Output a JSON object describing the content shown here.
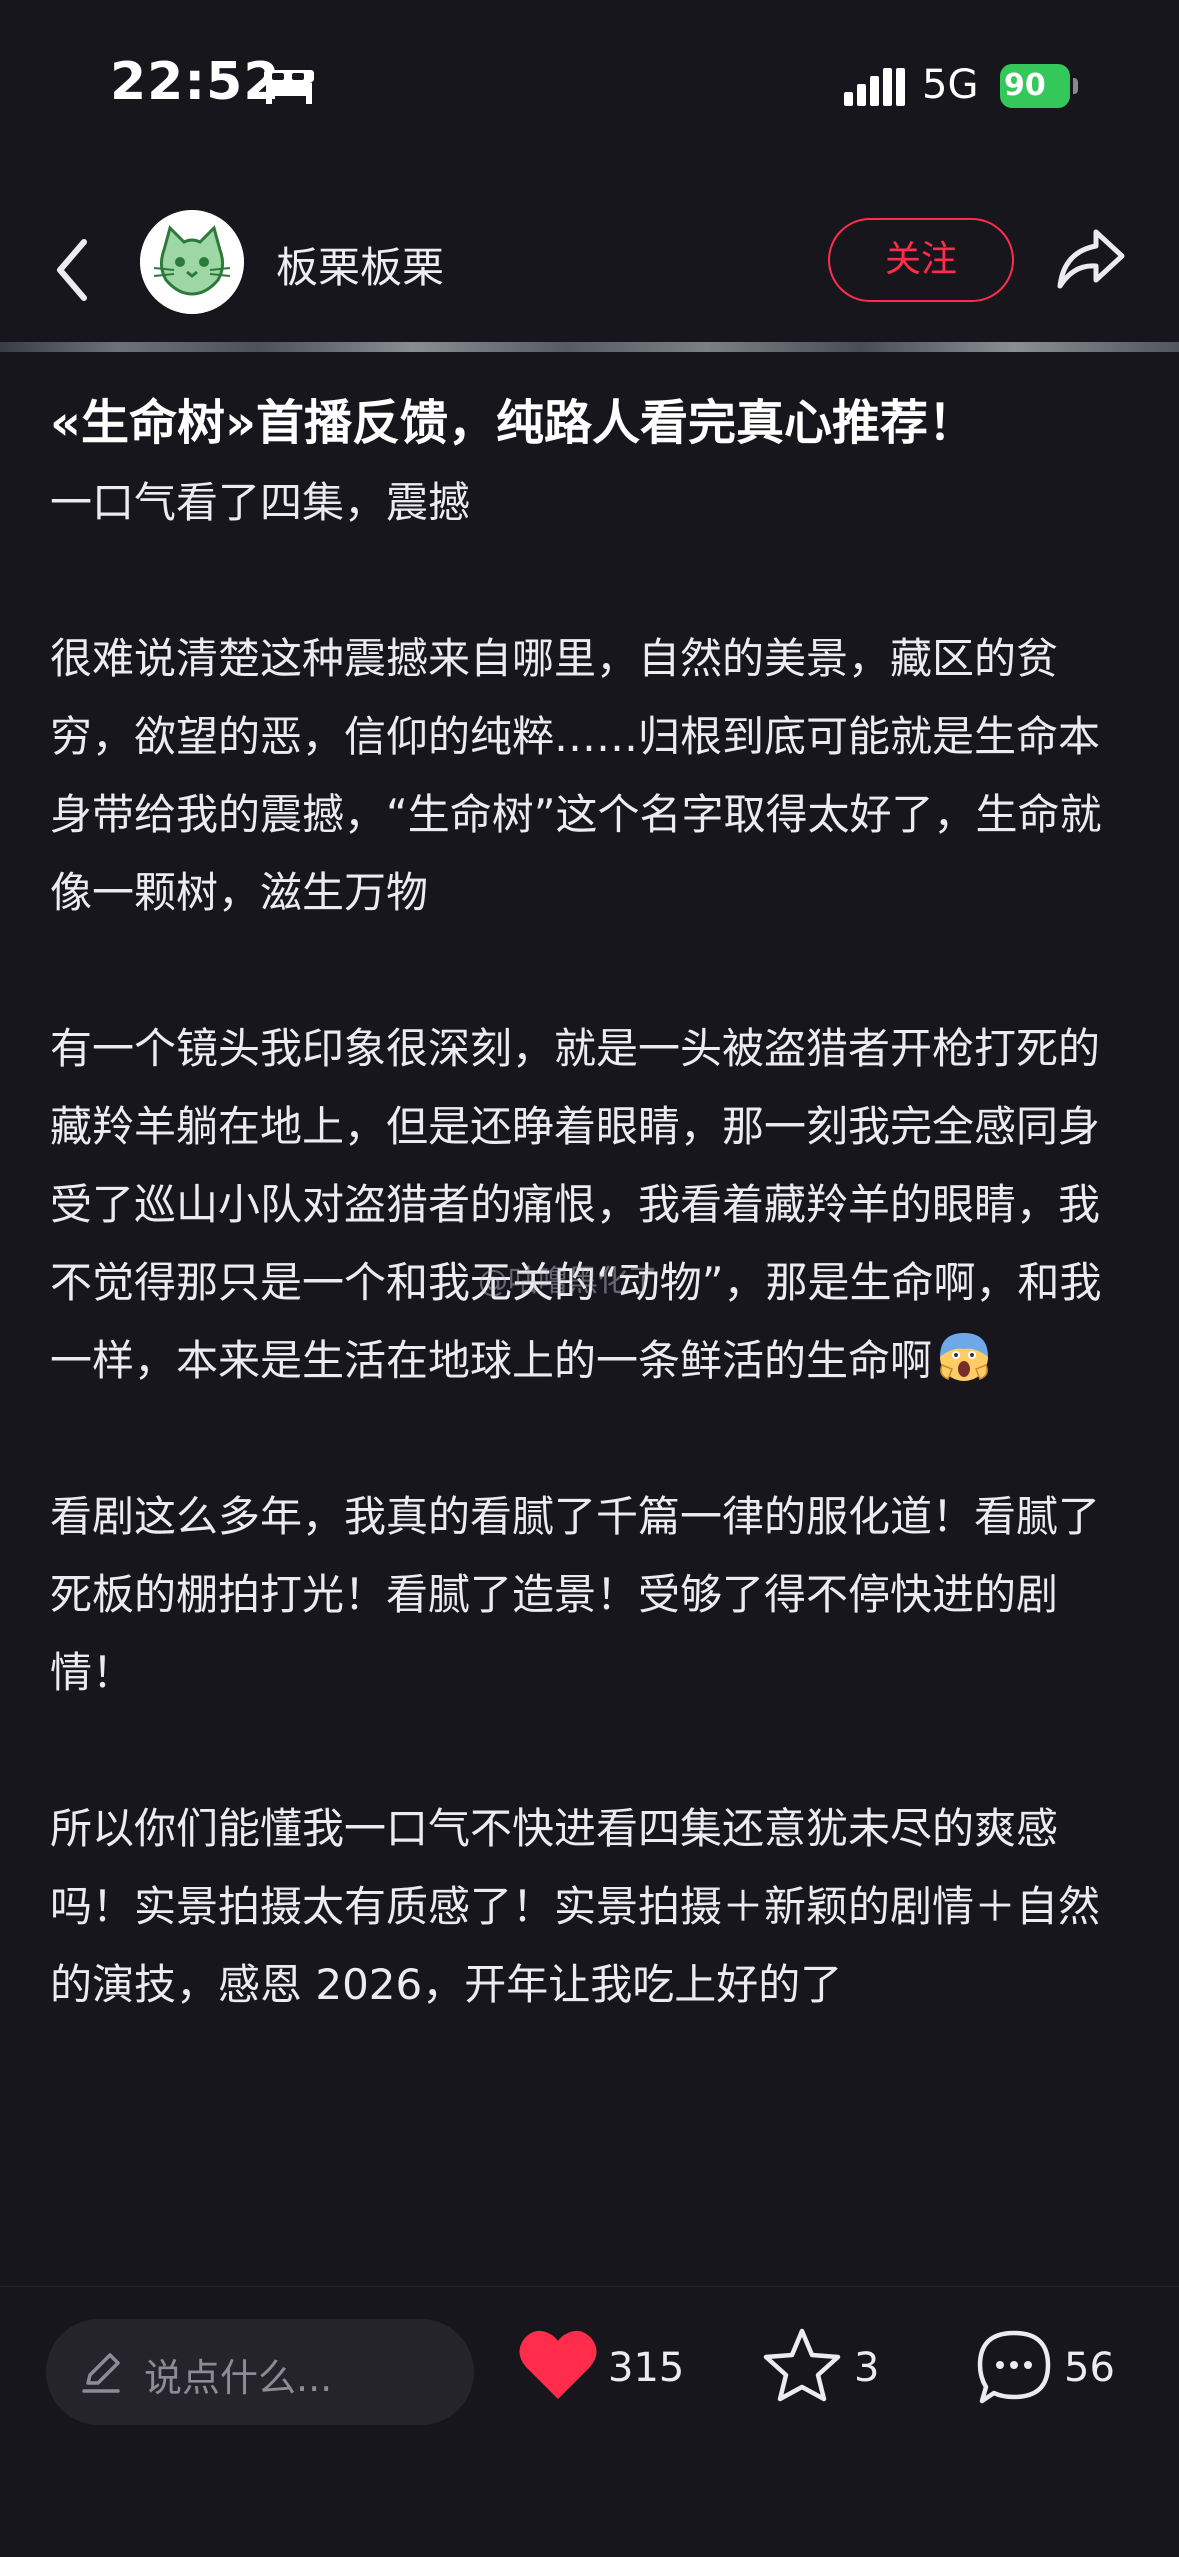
{
  "status": {
    "time": "22:52",
    "network": "5G",
    "battery": "90"
  },
  "nav": {
    "author": "板栗板栗",
    "follow_label": "关注"
  },
  "post": {
    "title": "«生命树»首播反馈，纯路人看完真心推荐！",
    "paragraphs": [
      "一口气看了四集，震撼",
      "很难说清楚这种震撼来自哪里，自然的美景，藏区的贫穷，欲望的恶，信仰的纯粹……归根到底可能就是生命本身带给我的震撼，“生命树”这个名字取得太好了，生命就像一颗树，滋生万物",
      "有一个镜头我印象很深刻，就是一头被盗猎者开枪打死的藏羚羊躺在地上，但是还睁着眼睛，那一刻我完全感同身受了巡山小队对盗猎者的痛恨，我看着藏羚羊的眼睛，我不觉得那只是一个和我无关的“动物”，那是生命啊，和我一样，本来是生活在地球上的一条鲜活的生命啊",
      "看剧这么多年，我真的看腻了千篇一律的服化道！看腻了死板的棚拍打光！看腻了造景！受够了得不停快进的剧情！",
      "所以你们能懂我一口气不快进看四集还意犹未尽的爽感吗！实景拍摄太有质感了！实景拍摄＋新颖的剧情＋自然的演技，感恩 2026，开年让我吃上好的了"
    ],
    "watermark": "@咕噜黑化了"
  },
  "bottom": {
    "comment_placeholder": "说点什么...",
    "likes": "315",
    "favorites": "3",
    "comments": "56"
  },
  "colors": {
    "background": "#17161d",
    "accent_red": "#ff2d4b",
    "battery_green": "#34c759"
  },
  "icons": [
    "bed-icon",
    "signal-icon",
    "back-icon",
    "cat-avatar",
    "share-icon",
    "screaming-face-emoji",
    "pen-icon",
    "heart-icon",
    "star-icon",
    "comment-bubble-icon"
  ]
}
